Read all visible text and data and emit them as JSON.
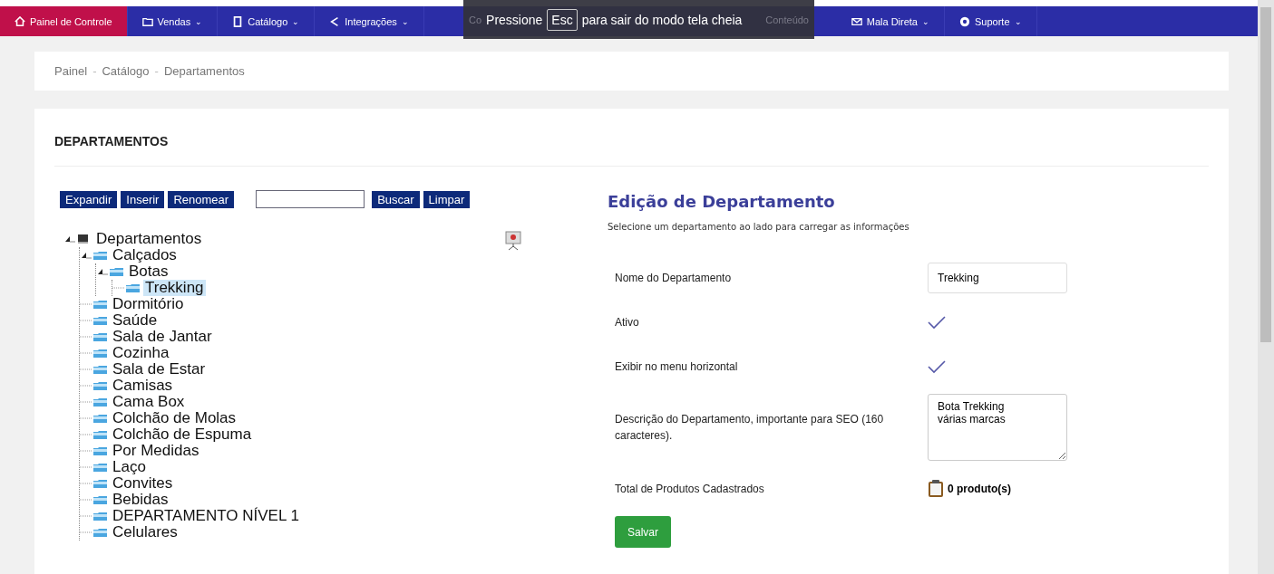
{
  "navbar": {
    "items": [
      {
        "label": "Painel de Controle",
        "selected": true
      },
      {
        "label": "Vendas",
        "caret": "⌄",
        "selected": false
      },
      {
        "label": "Catálogo",
        "caret": "⌄",
        "selected": false
      },
      {
        "label": "Integrações",
        "caret": "⌄",
        "selected": false
      }
    ],
    "items_right": [
      {
        "label": "Mala Direta",
        "caret": "⌄",
        "selected": false
      },
      {
        "label": "Suporte",
        "caret": "⌄",
        "selected": false
      }
    ]
  },
  "fullscreen_notice": {
    "fragment_left": "Co",
    "before": "Pressione",
    "key": "Esc",
    "after": "para sair do modo tela cheia",
    "fragment_right": "Conteúdo"
  },
  "breadcrumb": [
    {
      "kind": "link",
      "text": "Painel"
    },
    {
      "kind": "separator",
      "text": "-"
    },
    {
      "kind": "link",
      "text": "Catálogo"
    },
    {
      "kind": "separator",
      "text": "-"
    },
    {
      "kind": "link",
      "text": "Departamentos"
    }
  ],
  "page_title": "DEPARTAMENTOS",
  "tree_toolbar": {
    "buttons_left": [
      "Expandir",
      "Inserir",
      "Renomear"
    ],
    "buttons_right": [
      "Buscar",
      "Limpar"
    ]
  },
  "tree": {
    "label": "Departamentos",
    "kind": "root",
    "expanded": true,
    "selected": false,
    "children": [
      {
        "label": "Calçados",
        "kind": "folder",
        "expanded": true,
        "selected": false,
        "children": [
          {
            "label": "Botas",
            "kind": "folder",
            "expanded": true,
            "selected": false,
            "children": [
              {
                "label": "Trekking",
                "kind": "folder",
                "expanded": false,
                "selected": true
              }
            ]
          }
        ]
      },
      {
        "label": "Dormitório",
        "kind": "folder",
        "expanded": false,
        "selected": false
      },
      {
        "label": "Saúde",
        "kind": "folder",
        "expanded": false,
        "selected": false
      },
      {
        "label": "Sala de Jantar",
        "kind": "folder",
        "expanded": false,
        "selected": false
      },
      {
        "label": "Cozinha",
        "kind": "folder",
        "expanded": false,
        "selected": false
      },
      {
        "label": "Sala de Estar",
        "kind": "folder",
        "expanded": false,
        "selected": false
      },
      {
        "label": "Camisas",
        "kind": "folder",
        "expanded": false,
        "selected": false
      },
      {
        "label": "Cama Box",
        "kind": "folder",
        "expanded": false,
        "selected": false
      },
      {
        "label": "Colchão de Molas",
        "kind": "folder",
        "expanded": false,
        "selected": false
      },
      {
        "label": "Colchão de Espuma",
        "kind": "folder",
        "expanded": false,
        "selected": false
      },
      {
        "label": "Por Medidas",
        "kind": "folder",
        "expanded": false,
        "selected": false
      },
      {
        "label": "Laço",
        "kind": "folder",
        "expanded": false,
        "selected": false
      },
      {
        "label": "Convites",
        "kind": "folder",
        "expanded": false,
        "selected": false
      },
      {
        "label": "Bebidas",
        "kind": "folder",
        "expanded": false,
        "selected": false
      },
      {
        "label": "DEPARTAMENTO NÍVEL 1",
        "kind": "folder",
        "expanded": false,
        "selected": false
      },
      {
        "label": "Celulares",
        "kind": "folder",
        "expanded": false,
        "selected": false
      }
    ]
  },
  "editor": {
    "title": "Edição de Departamento",
    "subtitle": "Selecione um departamento ao lado para carregar as informações",
    "fields": [
      {
        "kind": "text",
        "label": "Nome do Departamento",
        "value": "Trekking"
      },
      {
        "kind": "check",
        "label": "Ativo",
        "checked": true
      },
      {
        "kind": "check",
        "label": "Exibir no menu horizontal",
        "checked": true
      },
      {
        "kind": "textarea",
        "label": "Descrição do Departamento, importante para SEO (160 caracteres).",
        "value": "Bota Trekking\nvárias marcas"
      },
      {
        "kind": "count",
        "label": "Total de Produtos Cadastrados",
        "value": "0 produto(s)"
      }
    ],
    "save_button": "Salvar"
  }
}
